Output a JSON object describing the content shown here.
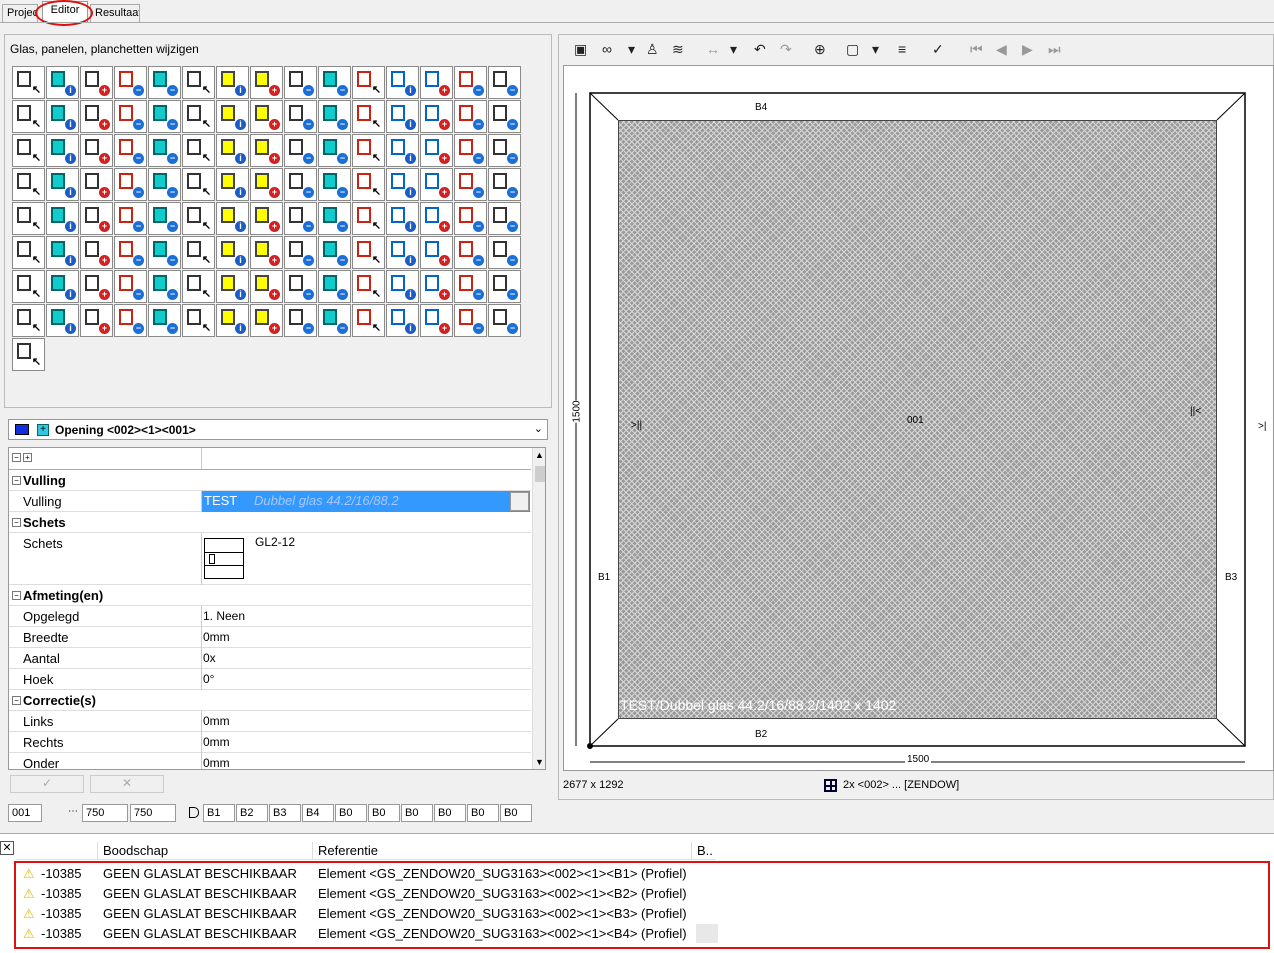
{
  "tabs": [
    "Project",
    "Editor",
    "Resultaat"
  ],
  "editor": {
    "title": "Glas, panelen, planchetten wijzigen",
    "opening": "Opening <002><1><001>",
    "props": {
      "vulling_sec": "Vulling",
      "vulling_label": "Vulling",
      "vulling_code": "TEST",
      "vulling_desc": "Dubbel glas 44.2/16/88.2",
      "schets_sec": "Schets",
      "schets_label": "Schets",
      "schets_value": "GL2-12",
      "afmeting_sec": "Afmeting(en)",
      "rows": [
        {
          "k": "Opgelegd",
          "v": "1. Neen"
        },
        {
          "k": "Breedte",
          "v": "0mm"
        },
        {
          "k": "Aantal",
          "v": "0x"
        },
        {
          "k": "Hoek",
          "v": "0°"
        }
      ],
      "correctie_sec": "Correctie(s)",
      "rows2": [
        {
          "k": "Links",
          "v": "0mm"
        },
        {
          "k": "Rechts",
          "v": "0mm"
        },
        {
          "k": "Onder",
          "v": "0mm"
        }
      ]
    },
    "inputs": {
      "id": "001",
      "w1": "750",
      "w2": "750",
      "b": [
        "B1",
        "B2",
        "B3",
        "B4",
        "B0",
        "B0",
        "B0",
        "B0",
        "B0",
        "B0"
      ]
    }
  },
  "drawing": {
    "b1": "B1",
    "b2": "B2",
    "b3": "B3",
    "b4": "B4",
    "center": "001",
    "caption": "TEST/Dubbel glas 44.2/16/88.2/1402 x 1402",
    "width": "1500",
    "height": "1500",
    "left_mark": ">||",
    "right_mark": "||<",
    "far_right": ">|",
    "status_size": "2677 x 1292",
    "status_ref": "2x <002> ... [ZENDOW]"
  },
  "messages": {
    "headers": [
      "Boodschap",
      "Referentie",
      "B.."
    ],
    "rows": [
      {
        "code": "-10385",
        "msg": "GEEN GLASLAT BESCHIKBAAR",
        "ref": "Element <GS_ZENDOW20_SUG3163><002><1><B1> (Profiel)"
      },
      {
        "code": "-10385",
        "msg": "GEEN GLASLAT BESCHIKBAAR",
        "ref": "Element <GS_ZENDOW20_SUG3163><002><1><B2> (Profiel)"
      },
      {
        "code": "-10385",
        "msg": "GEEN GLASLAT BESCHIKBAAR",
        "ref": "Element <GS_ZENDOW20_SUG3163><002><1><B3> (Profiel)"
      },
      {
        "code": "-10385",
        "msg": "GEEN GLASLAT BESCHIKBAAR",
        "ref": "Element <GS_ZENDOW20_SUG3163><002><1><B4> (Profiel)"
      }
    ]
  },
  "colors": {
    "accent": "#3399ff",
    "alert": "#d11111"
  }
}
